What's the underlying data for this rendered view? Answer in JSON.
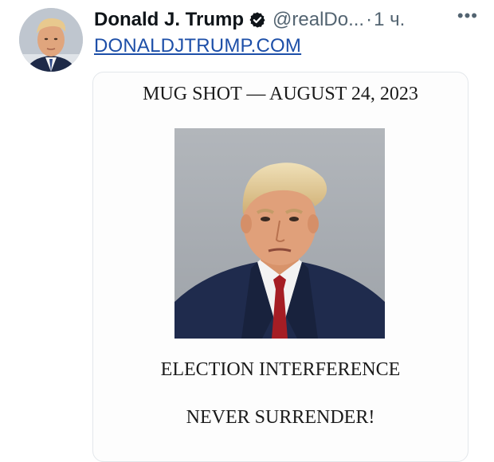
{
  "tweet": {
    "author_name": "Donald J. Trump",
    "handle": "@realDo...",
    "separator": "·",
    "time": "1 ч.",
    "more_label": "•••",
    "link_text": "DONALDJTRUMP.COM"
  },
  "card": {
    "caption_top": "MUG SHOT — AUGUST 24, 2023",
    "caption_middle": "ELECTION INTERFERENCE",
    "caption_bottom": "NEVER SURRENDER!"
  },
  "colors": {
    "verified_badge": "#0f1419",
    "link": "#1d4fa8",
    "secondary_text": "#536471",
    "photo_background": "#a9aeb4",
    "tie": "#a51d24"
  },
  "icons": {
    "verified": "verified-badge-icon",
    "more": "more-options-icon"
  }
}
